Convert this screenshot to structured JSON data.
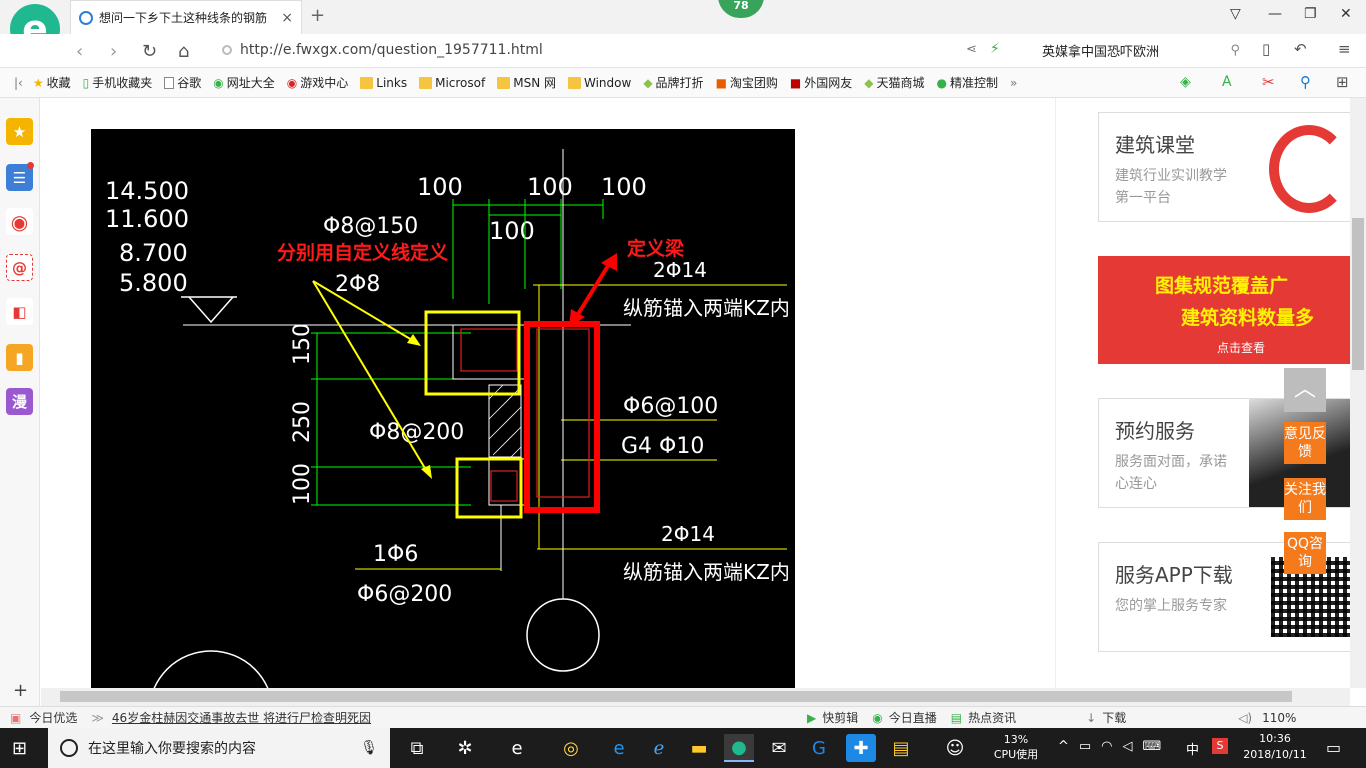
{
  "tab": {
    "title": "想问一下乡下土这种线条的钢筋",
    "close": "×",
    "new": "+"
  },
  "badge": "78",
  "address": {
    "url": "http://e.fwxgx.com/question_1957711.html",
    "search": "英媒拿中国恐吓欧洲"
  },
  "bookmarks": [
    "收藏",
    "手机收藏夹",
    "谷歌",
    "网址大全",
    "游戏中心",
    "Links",
    "Microsof",
    "MSN 网",
    "Window",
    "品牌打折",
    "淘宝团购",
    "外国网友",
    "天猫商城",
    "精准控制"
  ],
  "sidebar_icons": [
    "star-icon",
    "news-icon",
    "weibo-icon",
    "mail-icon",
    "game-icon",
    "book-icon",
    "manga-icon"
  ],
  "sidebar_manga": "漫",
  "cad": {
    "levels": [
      "14.500",
      "11.600",
      "8.700",
      "5.800"
    ],
    "top_dims": [
      "100",
      "100",
      "100"
    ],
    "mid_dim": "100",
    "phi8_150": "Φ8@150",
    "two_phi8": "2Φ8",
    "annotation_left": "分别用自定义线定义",
    "annotation_right": "定义梁",
    "two_phi14_top": "2Φ14",
    "anchor_top": "纵筋锚入两端KZ内",
    "phi6_100": "Φ6@100",
    "g4_phi10": "G4 Φ10",
    "phi8_200": "Φ8@200",
    "vdims": [
      "150",
      "250",
      "100"
    ],
    "one_phi6": "1Φ6",
    "phi6_200": "Φ6@200",
    "two_phi14_bot": "2Φ14",
    "anchor_bot": "纵筋锚入两端KZ内"
  },
  "right_cards": [
    {
      "title": "建筑课堂",
      "desc": "建筑行业实训教学第一平台"
    },
    {
      "banner1": "图集规范覆盖广",
      "banner2": "建筑资料数量多",
      "banner3": "点击查看"
    },
    {
      "title": "预约服务",
      "desc": "服务面对面，承诺心连心"
    },
    {
      "title": "服务APP下载",
      "desc": "您的掌上服务专家"
    }
  ],
  "float_buttons": [
    "意见反馈",
    "关注我们",
    "QQ咨询"
  ],
  "statusbar": {
    "today": "今日优选",
    "news": "46岁金柱赫因交通事故去世 将进行尸检查明死因",
    "items": [
      "快剪辑",
      "今日直播",
      "热点资讯",
      "下载"
    ],
    "zoom": "110%"
  },
  "taskbar": {
    "search_placeholder": "在这里输入你要搜索的内容",
    "cpu_pct": "13%",
    "cpu_label": "CPU使用",
    "ime": "中",
    "time": "10:36",
    "date": "2018/10/11"
  },
  "colors": {
    "brand_green": "#1fb88f",
    "cad_yellow": "#ffff00",
    "cad_red": "#ff0000",
    "cad_green": "#00ff00",
    "accent_orange": "#f47a1b"
  }
}
